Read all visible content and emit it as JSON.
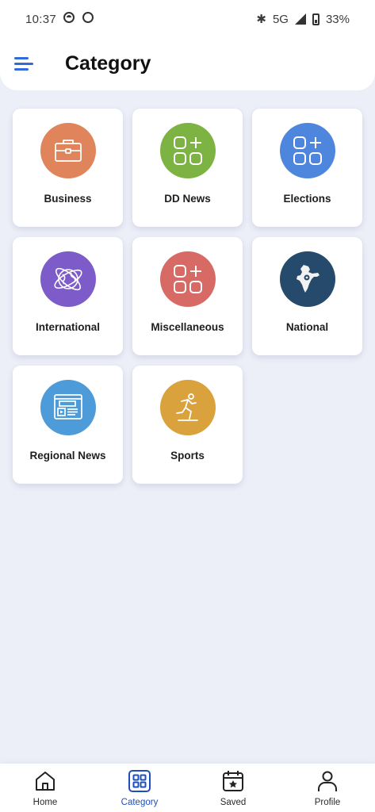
{
  "status_bar": {
    "time": "10:37",
    "network": "5G",
    "battery": "33%"
  },
  "header": {
    "title": "Category",
    "menu_icon": "hamburger-menu-icon",
    "accent_color": "#2f6bd9"
  },
  "categories": [
    {
      "label": "Business",
      "icon": "briefcase-icon",
      "color": "#e0845b"
    },
    {
      "label": "DD News",
      "icon": "grid-plus-icon",
      "color": "#7cb342"
    },
    {
      "label": "Elections",
      "icon": "grid-plus-icon",
      "color": "#4f86dd"
    },
    {
      "label": "International",
      "icon": "globe-orbit-icon",
      "color": "#7d5bc9"
    },
    {
      "label": "Miscellaneous",
      "icon": "grid-plus-icon",
      "color": "#d86a66"
    },
    {
      "label": "National",
      "icon": "india-map-icon",
      "color": "#264a6b"
    },
    {
      "label": "Regional News",
      "icon": "news-browser-icon",
      "color": "#4e9bd9"
    },
    {
      "label": "Sports",
      "icon": "runner-icon",
      "color": "#d9a23c"
    }
  ],
  "bottom_nav": [
    {
      "label": "Home",
      "icon": "home-icon",
      "active": false
    },
    {
      "label": "Category",
      "icon": "category-grid-icon",
      "active": true
    },
    {
      "label": "Saved",
      "icon": "calendar-star-icon",
      "active": false
    },
    {
      "label": "Profile",
      "icon": "person-icon",
      "active": false
    }
  ],
  "active_nav_color": "#1e4fb8"
}
